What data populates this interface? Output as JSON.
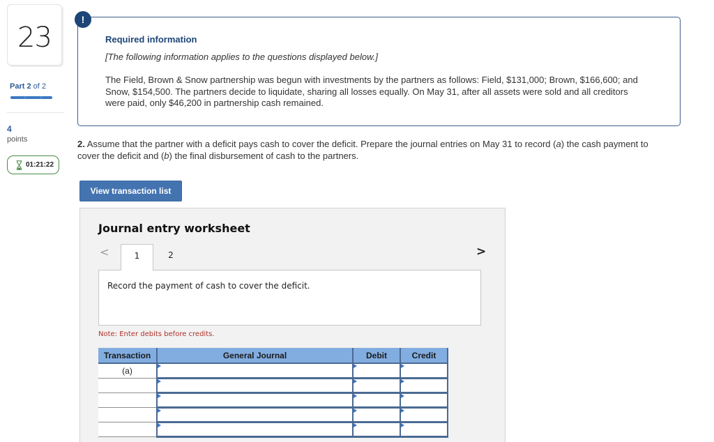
{
  "sidebar": {
    "question_number": "23",
    "part_prefix": "Part",
    "part_current": "2",
    "part_suffix": "of 2",
    "points_value": "4",
    "points_label": "points",
    "timer": {
      "icon": "hourglass-icon",
      "value": "01:21:22"
    }
  },
  "info": {
    "badge_icon": "exclamation-icon",
    "badge_text": "!",
    "title": "Required information",
    "subtitle": "[The following information applies to the questions displayed below.]",
    "body": "The Field, Brown & Snow partnership was begun with investments by the partners as follows: Field, $131,000; Brown, $166,600; and Snow, $154,500. The partners decide to liquidate, sharing all losses equally. On May 31, after all assets were sold and all creditors were paid, only $46,200 in partnership cash remained."
  },
  "question": {
    "number": "2.",
    "text_1": " Assume that the partner with a deficit pays cash to cover the deficit. Prepare the journal entries on May 31 to record (",
    "italic_a": "a",
    "text_2": ") the cash payment to cover the deficit and (",
    "italic_b": "b",
    "text_3": ") the final disbursement of cash to the partners."
  },
  "buttons": {
    "view_transaction_list": "View transaction list"
  },
  "worksheet": {
    "title": "Journal entry worksheet",
    "prev_icon": "<",
    "next_icon": ">",
    "tabs": [
      {
        "label": "1",
        "active": true
      },
      {
        "label": "2",
        "active": false
      }
    ],
    "description": "Record the payment of cash to cover the deficit.",
    "note": "Note: Enter debits before credits.",
    "table": {
      "headers": [
        "Transaction",
        "General Journal",
        "Debit",
        "Credit"
      ],
      "rows": [
        {
          "transaction": "(a)",
          "general_journal": "",
          "debit": "",
          "credit": ""
        },
        {
          "transaction": "",
          "general_journal": "",
          "debit": "",
          "credit": ""
        },
        {
          "transaction": "",
          "general_journal": "",
          "debit": "",
          "credit": ""
        },
        {
          "transaction": "",
          "general_journal": "",
          "debit": "",
          "credit": ""
        },
        {
          "transaction": "",
          "general_journal": "",
          "debit": "",
          "credit": ""
        }
      ]
    }
  },
  "colors": {
    "brand_blue": "#1d4577",
    "button_blue": "#4474b0",
    "table_header": "#82ade0",
    "table_border": "#4a6a93",
    "note_red": "#b0302a",
    "timer_green": "#4b8a47"
  }
}
